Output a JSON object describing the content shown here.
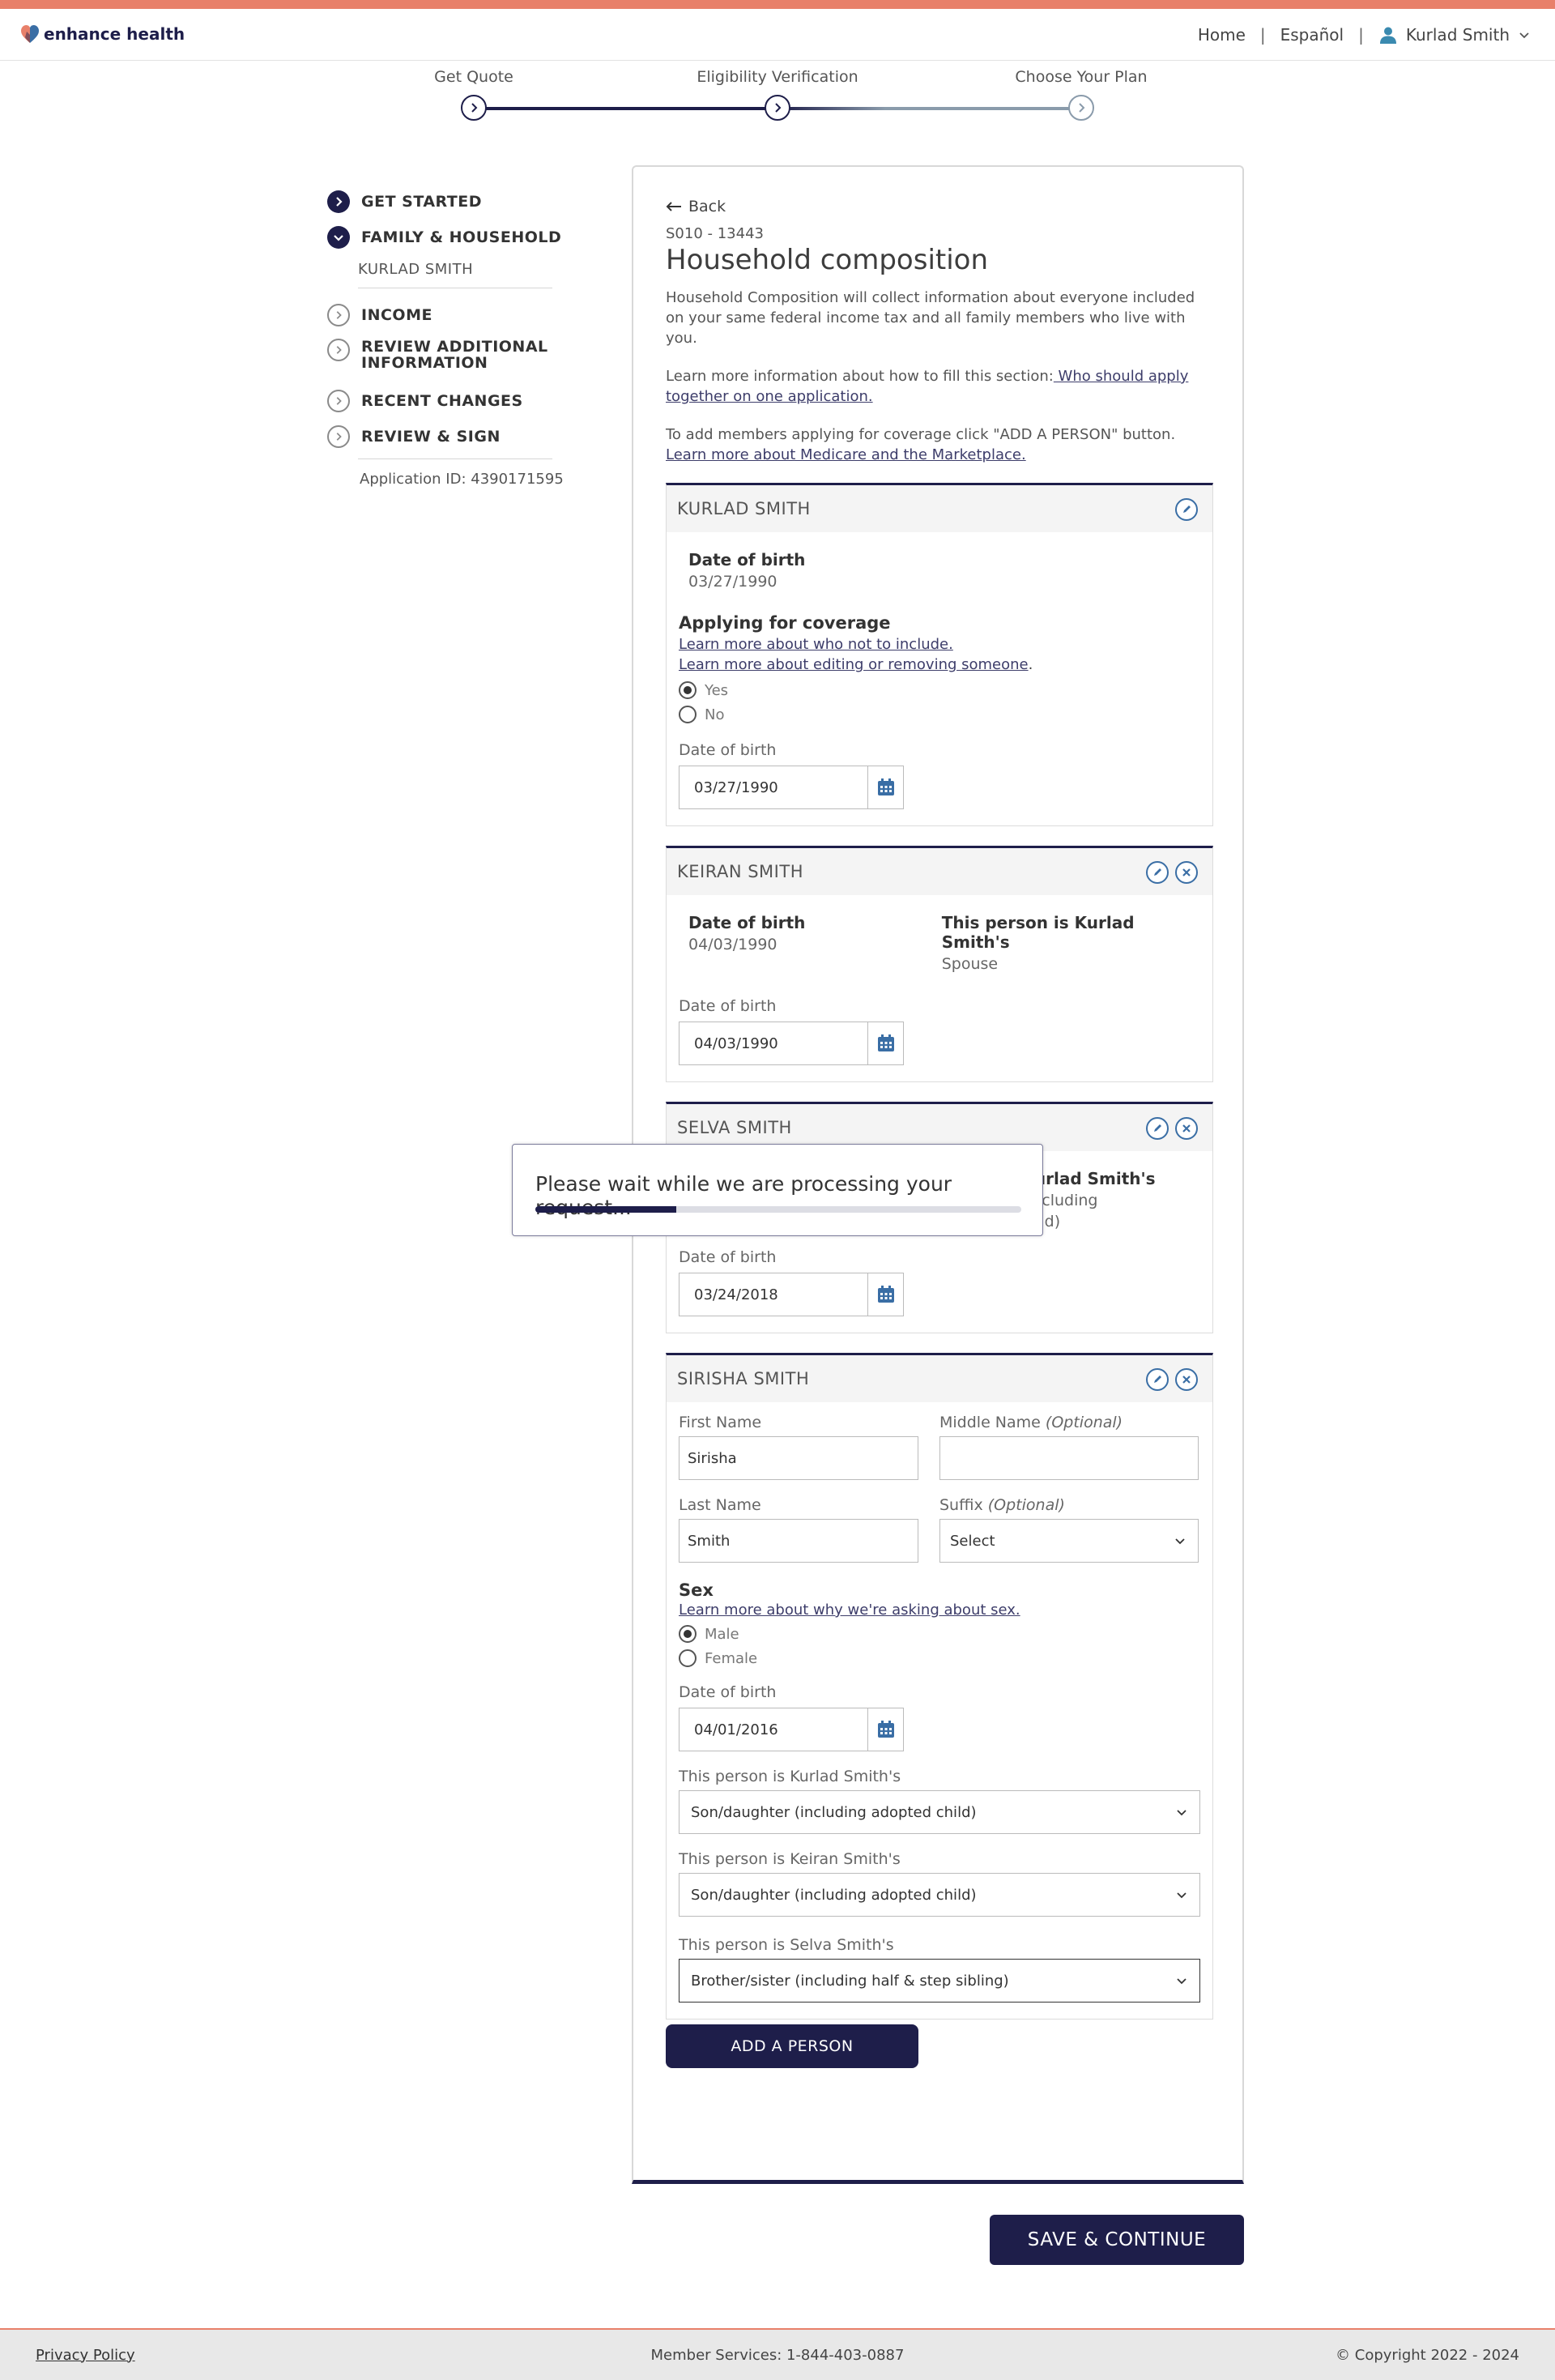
{
  "header": {
    "brand": "enhance health",
    "nav_home": "Home",
    "nav_sep": "|",
    "nav_language": "Español",
    "user_name": "Kurlad Smith"
  },
  "stepper": {
    "steps": [
      "Get Quote",
      "Eligibility Verification",
      "Choose Your Plan"
    ],
    "current_step": 2
  },
  "sidenav": {
    "items": [
      {
        "label": "GET STARTED",
        "status": "complete"
      },
      {
        "label": "FAMILY & HOUSEHOLD",
        "status": "complete",
        "sub": "KURLAD SMITH"
      },
      {
        "label": "INCOME",
        "status": "incomplete"
      },
      {
        "label": "REVIEW ADDITIONAL",
        "label2": "INFORMATION",
        "status": "incomplete"
      },
      {
        "label": "RECENT CHANGES",
        "status": "incomplete"
      },
      {
        "label": "REVIEW & SIGN",
        "status": "incomplete"
      }
    ],
    "application_id": "Application ID: 4390171595"
  },
  "main": {
    "back_label": "Back",
    "case_id": "S010 - 13443",
    "title": "Household composition",
    "intro": "Household Composition will collect information about everyone included on your same federal income tax and all family members who live with you.",
    "learn_more_prefix": "Learn more information about how to fill this section:",
    "learn_more_link": " Who should apply together on one application.",
    "add_members_text": "To add members applying for coverage click \"ADD A PERSON\" button.",
    "medicare_link": "Learn more about Medicare and the Marketplace."
  },
  "persons": [
    {
      "name": "KURLAD SMITH",
      "dob_label": "Date of birth",
      "dob": "03/27/1990",
      "coverage_title": "Applying for coverage",
      "link1": "Learn more about who not to include.",
      "link2": "Learn more about editing or removing someone",
      "link2_suffix": ".",
      "opt_yes": "Yes",
      "opt_no": "No",
      "selected": "Yes",
      "date_field_label": "Date of birth",
      "date_field_value": "03/27/1990"
    },
    {
      "name": "KEIRAN SMITH",
      "dob_label": "Date of birth",
      "dob": "04/03/1990",
      "relation_label": "This person is Kurlad Smith's",
      "relation": "Spouse",
      "date_field_label": "Date of birth",
      "date_field_value": "04/03/1990"
    },
    {
      "name": "SELVA SMITH",
      "relation_label_visible": "is Kurlad Smith's",
      "relation_visible_1": "er (including",
      "relation_visible_2": "adopted child)",
      "date_field_label": "Date of birth",
      "date_field_value": "03/24/2018"
    },
    {
      "name": "SIRISHA SMITH",
      "first_name_label": "First Name",
      "first_name": "Sirisha",
      "middle_name_label": "Middle Name",
      "optional": "(Optional)",
      "middle_name": "",
      "last_name_label": "Last Name",
      "last_name": "Smith",
      "suffix_label": "Suffix",
      "suffix_value": "Select",
      "sex_title": "Sex",
      "sex_link": "Learn more about why we're asking about sex.",
      "opt_male": "Male",
      "opt_female": "Female",
      "selected": "Male",
      "date_field_label": "Date of birth",
      "date_field_value": "04/01/2016",
      "rel1_label": "This person is Kurlad Smith's",
      "rel1_value": "Son/daughter (including adopted child)",
      "rel2_label": "This person is Keiran Smith's",
      "rel2_value": "Son/daughter (including adopted child)",
      "rel3_label": "This person is Selva Smith's",
      "rel3_value": "Brother/sister (including half & step sibling)"
    }
  ],
  "add_person_label": "ADD A PERSON",
  "save_label": "SAVE & CONTINUE",
  "modal": {
    "text": "Please wait while we are processing your request...",
    "progress": 0.29
  },
  "footer": {
    "privacy": "Privacy Policy",
    "member_services": "Member Services: 1-844-403-0887",
    "copyright": "© Copyright 2022 - 2024"
  },
  "colors": {
    "brand_navy": "#1e1e4a",
    "accent_coral": "#e8806a",
    "icon_blue": "#3a6ea5"
  }
}
